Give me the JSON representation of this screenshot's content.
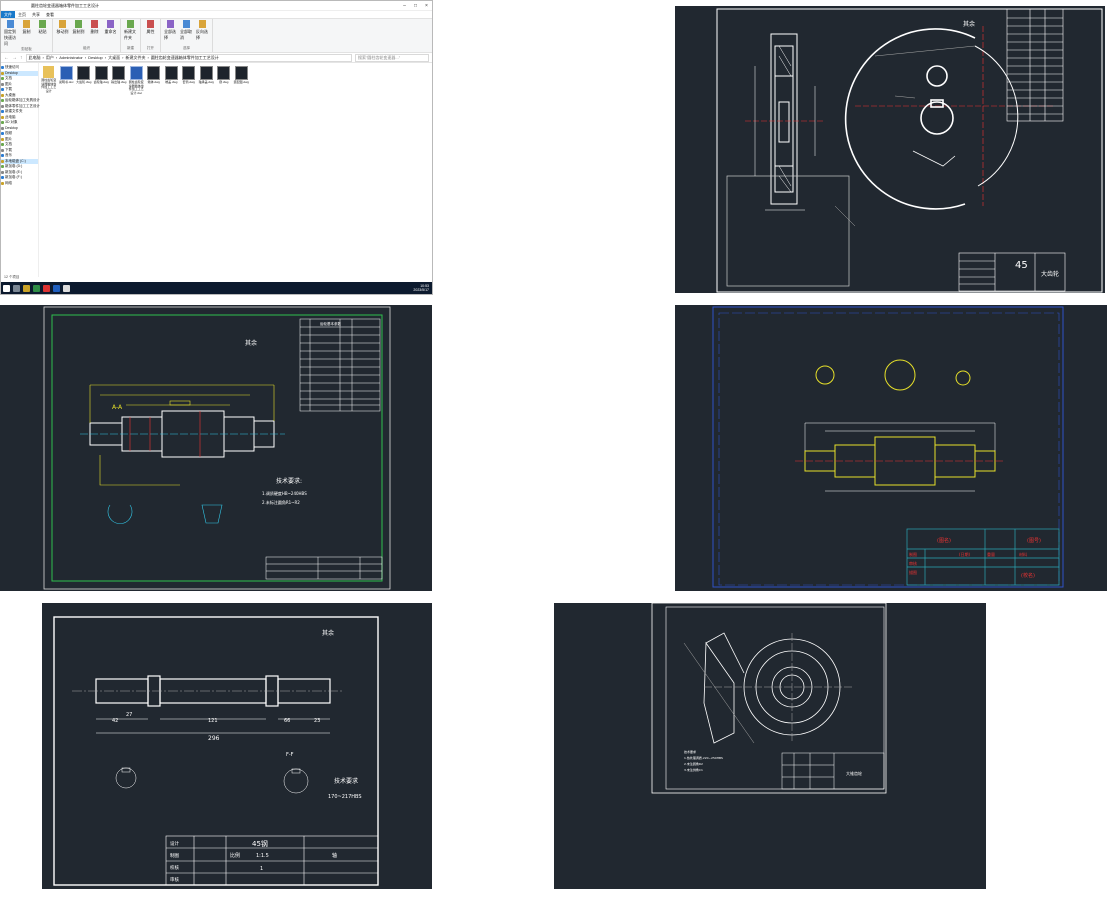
{
  "explorer": {
    "window_title": "圆柱齿轮变速器箱体零件加工工艺设计",
    "ribbon_tabs": [
      "文件",
      "主页",
      "共享",
      "查看"
    ],
    "ribbon_groups": [
      {
        "name": "剪贴板",
        "buttons": [
          "固定到快速访问",
          "复制",
          "粘贴"
        ]
      },
      {
        "name": "组织",
        "buttons": [
          "移动到",
          "复制到",
          "删除",
          "重命名"
        ]
      },
      {
        "name": "新建",
        "buttons": [
          "新建文件夹"
        ]
      },
      {
        "name": "打开",
        "buttons": [
          "属性"
        ]
      },
      {
        "name": "选择",
        "buttons": [
          "全部选择",
          "全部取消",
          "反向选择"
        ]
      }
    ],
    "address_path": [
      "此电脑",
      "用户",
      "Administrator",
      "Desktop",
      "大桌面",
      "新建文件夹",
      "圆柱齿轮变速器箱体零件加工工艺设计"
    ],
    "search_placeholder": "搜索\"圆柱齿轮变速器...\"",
    "nav_items": [
      {
        "label": "快速访问",
        "sel": false
      },
      {
        "label": "Desktop",
        "sel": true
      },
      {
        "label": "文档",
        "sel": false
      },
      {
        "label": "图片",
        "sel": false
      },
      {
        "label": "下载",
        "sel": false
      },
      {
        "label": "大桌面",
        "sel": false
      },
      {
        "label": "齿轮箱体加工夹具设计",
        "sel": false
      },
      {
        "label": "箱体零件加工工艺设计",
        "sel": false
      },
      {
        "label": "新建文件夹",
        "sel": false
      },
      {
        "label": "此电脑",
        "sel": false
      },
      {
        "label": "3D 对象",
        "sel": false
      },
      {
        "label": "Desktop",
        "sel": false
      },
      {
        "label": "视频",
        "sel": false
      },
      {
        "label": "图片",
        "sel": false
      },
      {
        "label": "文档",
        "sel": false
      },
      {
        "label": "下载",
        "sel": false
      },
      {
        "label": "音乐",
        "sel": false
      },
      {
        "label": "本地磁盘 (C:)",
        "sel": true
      },
      {
        "label": "新加卷 (D:)",
        "sel": false
      },
      {
        "label": "新加卷 (E:)",
        "sel": false
      },
      {
        "label": "新加卷 (F:)",
        "sel": false
      },
      {
        "label": "网络",
        "sel": false
      }
    ],
    "files": [
      {
        "name": "圆柱齿轮变速器箱体零件加工工艺设计",
        "kind": "folder"
      },
      {
        "name": "说明书.doc",
        "kind": "word"
      },
      {
        "name": "大齿轮.dwg",
        "kind": "dwg"
      },
      {
        "name": "齿轮轴.dwg",
        "kind": "dwg"
      },
      {
        "name": "输出轴.dwg",
        "kind": "dwg"
      },
      {
        "name": "圆柱齿轮变速器箱体零件加工工艺设计.doc",
        "kind": "word"
      },
      {
        "name": "箱体.dwg",
        "kind": "dwg"
      },
      {
        "name": "端盖.dwg",
        "kind": "dwg"
      },
      {
        "name": "套筒.dwg",
        "kind": "dwg"
      },
      {
        "name": "轴承盖.dwg",
        "kind": "dwg"
      },
      {
        "name": "键.dwg",
        "kind": "dwg"
      },
      {
        "name": "装配图.dwg",
        "kind": "dwg"
      }
    ],
    "status": "12 个项目",
    "clock_time": "10:53",
    "clock_date": "2023/5/17"
  },
  "drawings": {
    "gear": {
      "roughness_note": "其余",
      "material": "45",
      "part_name": "大齿轮"
    },
    "shaft1": {
      "roughness_note": "其余",
      "section_label": "A-A",
      "tech_title": "技术要求:",
      "tech_lines": [
        "1.调质硬度HB~240HBS",
        "2.未标注圆角R1~R2"
      ],
      "table_header": "齿轮基本参数"
    },
    "shaft2": {
      "title_red_1": "(图名)",
      "title_red_2": "(图号)",
      "title_red_3": "(校名)",
      "rows": [
        "制图",
        "审核",
        "描图"
      ],
      "date": "(日期)",
      "weight": "重量",
      "material": "材料"
    },
    "shaft3": {
      "roughness_note": "其余",
      "total_length": "296",
      "dims": [
        "42",
        "121",
        "66",
        "23",
        "27"
      ],
      "section_label": "F-F",
      "tech_title": "技术要求",
      "tech_line": "170~217HBS",
      "material": "45钢",
      "scale_label": "比例",
      "scale": "1:1.5",
      "part_name": "轴",
      "qty": "1",
      "table_rows": [
        "设计",
        "制图",
        "校核",
        "审核"
      ]
    },
    "bevel": {
      "part_name": "大锥齿轮",
      "tech_lines": [
        "技术要求",
        "1.热处理调质,220~250HBS",
        "2.未注圆角R2",
        "3.未注倒角C1"
      ]
    }
  }
}
